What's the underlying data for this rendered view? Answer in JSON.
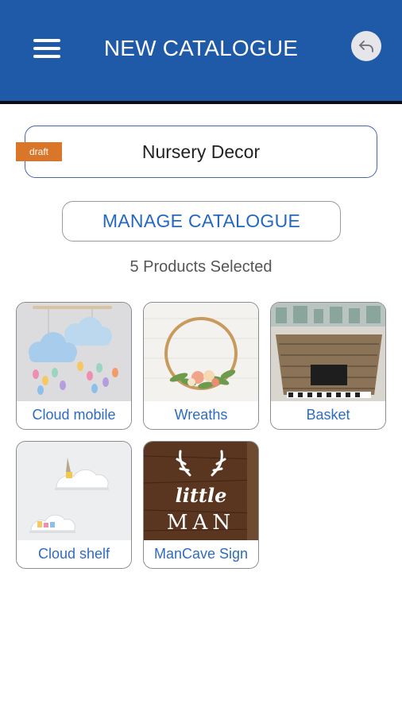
{
  "header": {
    "title": "NEW CATALOGUE",
    "menu_icon": "hamburger-menu-icon",
    "back_icon": "reply-arrow-icon",
    "background_color": "#1e5aa8"
  },
  "catalogue": {
    "name": "Nursery Decor",
    "status_badge": "draft",
    "badge_color": "#d9762a"
  },
  "manage_button": {
    "label": "MANAGE CATALOGUE",
    "label_color": "#2468c2"
  },
  "selection": {
    "summary": "5 Products Selected"
  },
  "products": [
    {
      "name": "Cloud mobile"
    },
    {
      "name": "Wreaths"
    },
    {
      "name": "Basket"
    },
    {
      "name": "Cloud shelf"
    },
    {
      "name": "ManCave Sign",
      "image_text_top": "little",
      "image_text_bottom": "MAN"
    }
  ]
}
